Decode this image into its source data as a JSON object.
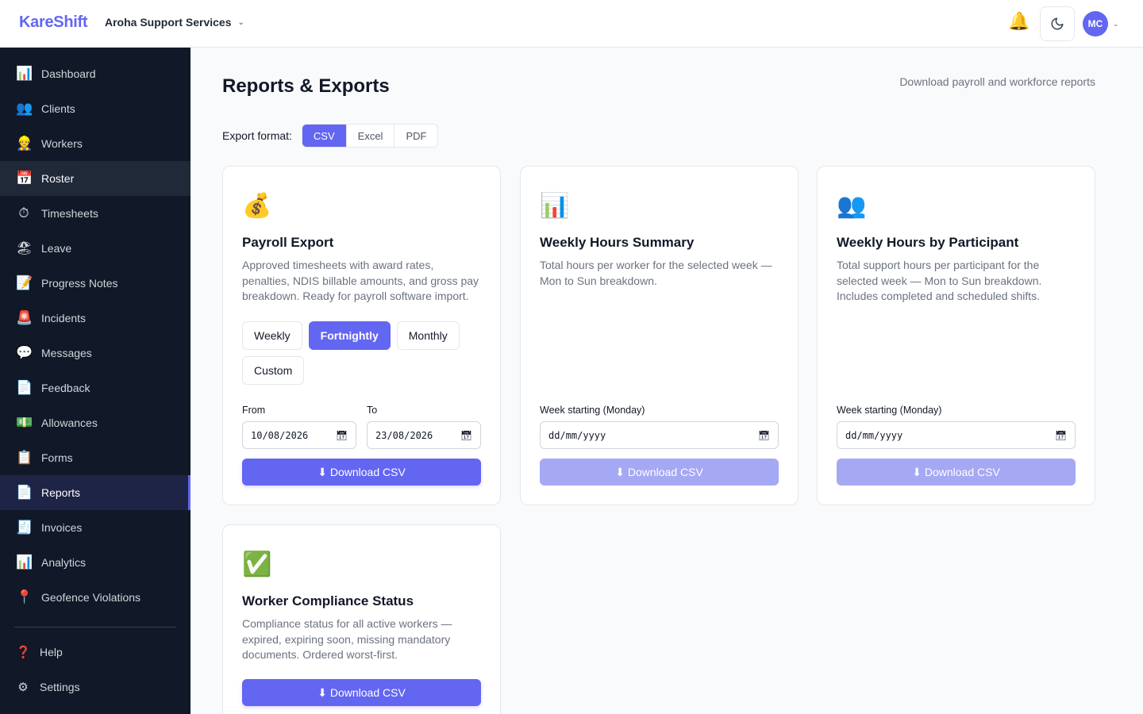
{
  "app": {
    "logo": "KareShift",
    "org_name": "Aroha Support Services"
  },
  "header": {
    "avatar_initials": "MC"
  },
  "sidebar": {
    "items": [
      {
        "label": "Dashboard",
        "icon": "📊"
      },
      {
        "label": "Clients",
        "icon": "👥"
      },
      {
        "label": "Workers",
        "icon": "👷"
      },
      {
        "label": "Roster",
        "icon": "📅"
      },
      {
        "label": "Timesheets",
        "icon": "⏱"
      },
      {
        "label": "Leave",
        "icon": "🏖"
      },
      {
        "label": "Progress Notes",
        "icon": "📝"
      },
      {
        "label": "Incidents",
        "icon": "🚨"
      },
      {
        "label": "Messages",
        "icon": "💬"
      },
      {
        "label": "Feedback",
        "icon": "📄"
      },
      {
        "label": "Allowances",
        "icon": "💵"
      },
      {
        "label": "Forms",
        "icon": "📋"
      },
      {
        "label": "Reports",
        "icon": "📄"
      },
      {
        "label": "Invoices",
        "icon": "🧾"
      },
      {
        "label": "Analytics",
        "icon": "📊"
      },
      {
        "label": "Geofence Violations",
        "icon": "📍"
      }
    ],
    "bottom": [
      {
        "label": "Help",
        "icon": "❓"
      },
      {
        "label": "Settings",
        "icon": "⚙"
      }
    ],
    "active_item": "Reports",
    "hover_item": "Roster"
  },
  "page": {
    "title": "Reports & Exports",
    "subtitle": "Download payroll and workforce reports",
    "format_label": "Export format:",
    "formats": [
      "CSV",
      "Excel",
      "PDF"
    ],
    "selected_format": "CSV"
  },
  "cards": {
    "payroll": {
      "icon": "💰",
      "title": "Payroll Export",
      "description": "Approved timesheets with award rates, penalties, NDIS billable amounts, and gross pay breakdown. Ready for payroll software import.",
      "periods": [
        "Weekly",
        "Fortnightly",
        "Monthly",
        "Custom"
      ],
      "selected_period": "Fortnightly",
      "from_label": "From",
      "from_value": "10/08/2026",
      "to_label": "To",
      "to_value": "23/08/2026",
      "button": "⬇ Download CSV"
    },
    "weekly_hours": {
      "icon": "📊",
      "title": "Weekly Hours Summary",
      "description": "Total hours per worker for the selected week — Mon to Sun breakdown.",
      "week_label": "Week starting (Monday)",
      "week_value": "dd/mm/yyyy",
      "button": "⬇ Download CSV"
    },
    "participant_hours": {
      "icon": "👥",
      "title": "Weekly Hours by Participant",
      "description": "Total support hours per participant for the selected week — Mon to Sun breakdown. Includes completed and scheduled shifts.",
      "week_label": "Week starting (Monday)",
      "week_value": "dd/mm/yyyy",
      "button": "⬇ Download CSV"
    },
    "compliance": {
      "icon": "✅",
      "title": "Worker Compliance Status",
      "description": "Compliance status for all active workers — expired, expiring soon, missing mandatory documents. Ordered worst-first.",
      "button": "⬇ Download CSV"
    }
  },
  "colors": {
    "accent": "#6366f1",
    "sidebar_bg": "#111827",
    "disabled_button": "#a5a8f3"
  }
}
